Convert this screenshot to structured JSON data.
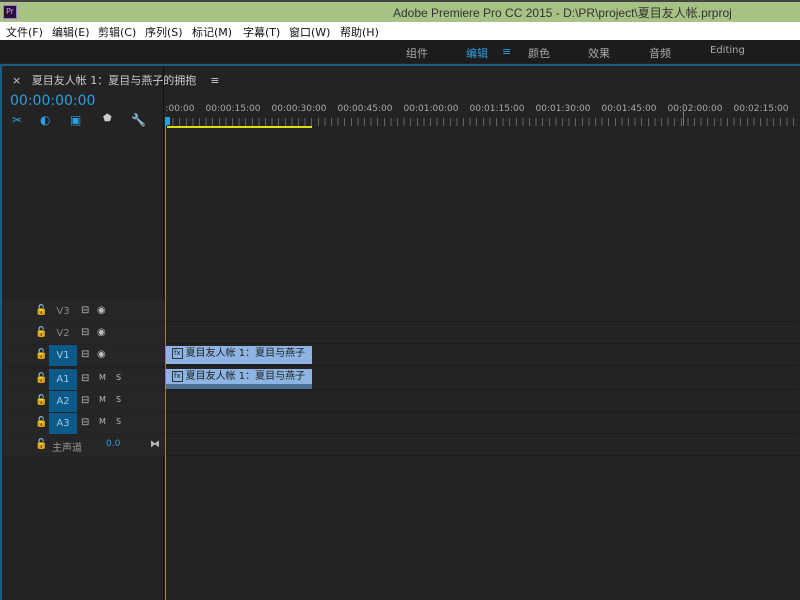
{
  "window": {
    "title": "Adobe Premiere Pro CC 2015 - D:\\PR\\project\\夏目友人帐.prproj",
    "logo": "Pr"
  },
  "menu": [
    "文件(F)",
    "编辑(E)",
    "剪辑(C)",
    "序列(S)",
    "标记(M)",
    "字幕(T)",
    "窗口(W)",
    "帮助(H)"
  ],
  "workspaces": [
    {
      "label": "组件"
    },
    {
      "label": "编辑",
      "active": true
    },
    {
      "label": "颜色"
    },
    {
      "label": "效果"
    },
    {
      "label": "音频"
    },
    {
      "label": "Editing"
    }
  ],
  "workspace_menu_icon": "≡",
  "panel": {
    "close": "×",
    "title": "夏目友人帐 1：夏目与燕子的拥抱",
    "menu": "≡",
    "timecode": "00:00:00:00"
  },
  "ruler": [
    ":00:00",
    "00:00:15:00",
    "00:00:30:00",
    "00:00:45:00",
    "00:01:00:00",
    "00:01:15:00",
    "00:01:30:00",
    "00:01:45:00",
    "00:02:00:00",
    "00:02:15:00"
  ],
  "tracks": [
    {
      "name": "V3",
      "type": "video",
      "targeted": false
    },
    {
      "name": "V2",
      "type": "video",
      "targeted": false
    },
    {
      "name": "V1",
      "type": "video",
      "targeted": true,
      "clip": "夏目友人帐 1：夏目与燕子"
    },
    {
      "name": "A1",
      "type": "audio",
      "targeted": true,
      "m": "M",
      "s": "S",
      "clip": "夏目友人帐 1：夏目与燕子"
    },
    {
      "name": "A2",
      "type": "audio",
      "targeted": true,
      "m": "M",
      "s": "S"
    },
    {
      "name": "A3",
      "type": "audio",
      "targeted": true,
      "m": "M",
      "s": "S"
    }
  ],
  "master": {
    "label": "主声道",
    "value": "0.0"
  },
  "clip_fx": "fx"
}
